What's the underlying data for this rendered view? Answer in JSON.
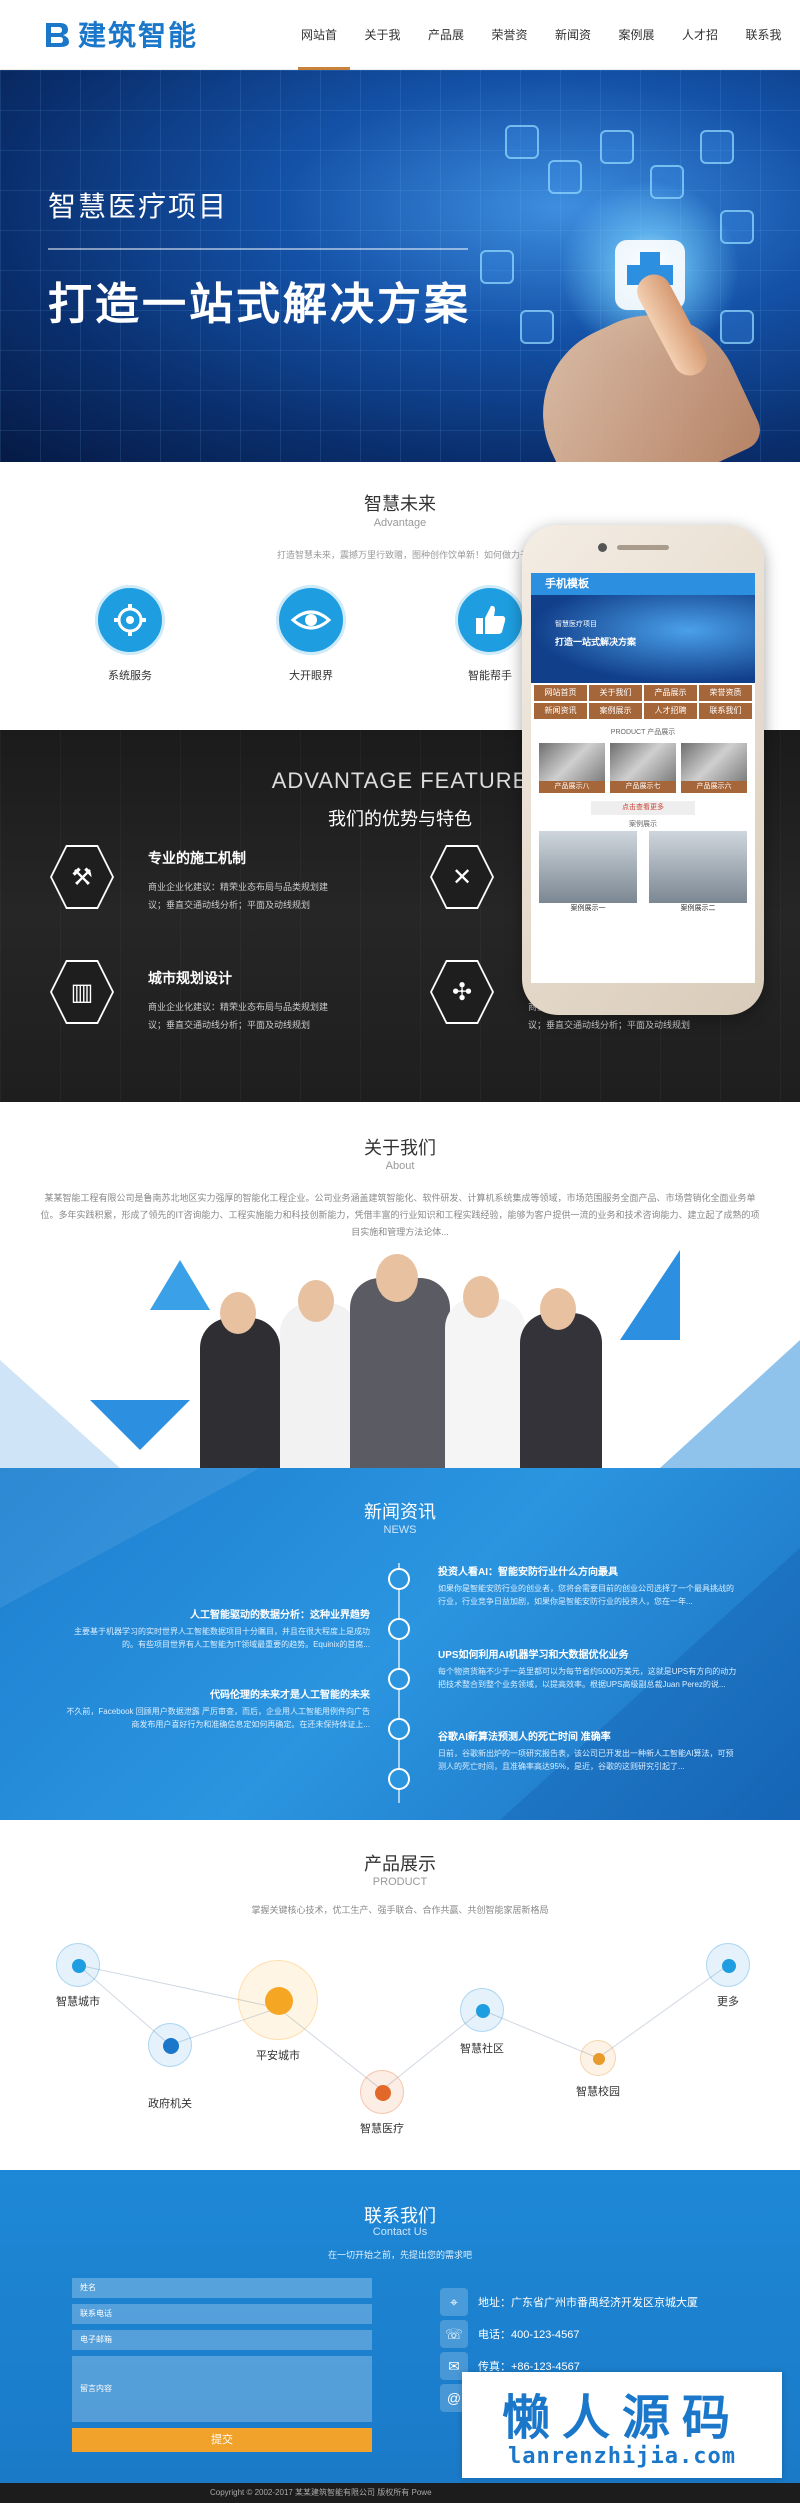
{
  "header": {
    "logo_text": "建筑智能",
    "nav": [
      "网站首页",
      "关于我们",
      "产品展示",
      "荣誉资质",
      "新闻资讯",
      "案例展示",
      "人才招聘",
      "联系我们"
    ]
  },
  "banner": {
    "title": "智慧医疗项目",
    "subtitle": "打造一站式解决方案"
  },
  "services": {
    "title": "智慧未来",
    "subtitle": "Advantage",
    "desc": "打造智慧未来，震撼万里行致赠，图种创作饮单新！如何做力于绿色智能营建",
    "items": [
      {
        "label": "系统服务",
        "icon": "gear-icon"
      },
      {
        "label": "大开眼界",
        "icon": "eye-icon"
      },
      {
        "label": "智能帮手",
        "icon": "thumbs-up-icon"
      }
    ]
  },
  "advantage": {
    "title_en": "ADVANTAGE FEATURE",
    "title_zh": "我们的优势与特色",
    "features": [
      {
        "title": "专业的施工机制",
        "desc": "商业企业化建议：精荣业态布局与品类规划建议；垂直交通动线分析；平面及动线规划",
        "icon": "crane-icon"
      },
      {
        "title": "城市规划设计",
        "desc": "商业企业化建议：精荣业态布局与品类规划建议；垂直交通动线分析；平面及动线规划",
        "icon": "buildings-icon"
      },
      {
        "title": "",
        "desc": "",
        "icon": "tools-icon"
      },
      {
        "title": "",
        "desc": "商业企业化建议：精荣业态布局与品类规划建议；垂直交通动线分析；平面及动线规划",
        "icon": "wind-turbine-icon"
      }
    ]
  },
  "about": {
    "title": "关于我们",
    "subtitle": "About",
    "desc": "某某智能工程有限公司是鲁南苏北地区实力强厚的智能化工程企业。公司业务涵盖建筑智能化、软件研发、计算机系统集成等领域，市场范围服务全面产品、市场营销化全面业务单位。多年实践积累，形成了领先的IT咨询能力、工程实施能力和科技创新能力，凭借丰富的行业知识和工程实践经验，能够为客户提供一流的业务和技术咨询能力、建立起了成熟的项目实施和管理方法论体..."
  },
  "news": {
    "title": "新闻资讯",
    "subtitle": "NEWS",
    "left": [
      {
        "title": "人工智能驱动的数据分析：这种业界趋势",
        "desc": "主要基于机器学习的实时世界人工智能数据项目十分瞩目，并且在很大程度上是成功的。有些项目世界有人工智能为IT领域最重要的趋势。Equinix的首席..."
      },
      {
        "title": "代码伦理的未来才是人工智能的未来",
        "desc": "不久前，Facebook 回顾用户数据泄露 严厉审查，而后，企业用人工智能用例件向广告商发布用户喜好行为和准确信息定如何再确定。在还未保持体证上..."
      }
    ],
    "right": [
      {
        "title": "投资人看AI：智能安防行业什么方向最具",
        "desc": "如果你是智能安防行业的创业者，您将会需要目前的创业公司选择了一个最具挑战的行业，行业竞争日益加剧，如果你是智能安防行业的投资人，您在一年..."
      },
      {
        "title": "UPS如何利用AI机器学习和大数据优化业务",
        "desc": "每个物资货箱不少于一英里都可以为每节省约5000万美元，这就是UPS有方向的动力把技术整合到整个业务领域，以提高效率。根据UPS高级副总裁Juan Perez的说..."
      },
      {
        "title": "谷歌AI新算法预测人的死亡时间 准确率",
        "desc": "日前，谷歌新出炉的一项研究报告表，该公司已开发出一种新人工智能AI算法，可预测人的死亡时间，且准确率高达95%，是近，谷歌的这则研究引起了..."
      }
    ]
  },
  "products": {
    "title": "产品展示",
    "subtitle": "PRODUCT",
    "desc": "掌握关键核心技术，优工生产、强手联合、合作共赢、共创智能家居新格局",
    "nodes": [
      "智慧城市",
      "政府机关",
      "平安城市",
      "智慧医疗",
      "智慧社区",
      "智慧校园",
      "更多"
    ]
  },
  "contact": {
    "title": "联系我们",
    "subtitle": "Contact Us",
    "desc": "在一切开始之前，先提出您的需求吧",
    "fields": [
      "姓名",
      "联系电话",
      "电子邮箱",
      "留言内容"
    ],
    "submit": "提交",
    "address": "地址：广东省广州市番禺经济开发区京城大厦",
    "phone": "电话：400-123-4567",
    "fax": "传真：+86-123-4567"
  },
  "footer": {
    "copyright": "Copyright © 2002-2017 某某建筑智能有限公司 版权所有 Powe"
  },
  "phone_mockup": {
    "app_title": "手机模板",
    "banner_t1": "智慧医疗项目",
    "banner_t2": "打造一站式解决方案",
    "nav": [
      "网站首页",
      "关于我们",
      "产品展示",
      "荣誉资质",
      "新闻资讯",
      "案例展示",
      "人才招聘",
      "联系我们"
    ],
    "product_head": "PRODUCT 产品展示",
    "products": [
      "产品展示八",
      "产品展示七",
      "产品展示六"
    ],
    "more": "点击查看更多",
    "case_head": "案例展示",
    "cases": [
      "案例展示一",
      "案例展示二"
    ]
  },
  "watermark": {
    "text": "懒人源码",
    "url": "lanrenzhijia.com"
  },
  "colors": {
    "brand": "#1a77c9",
    "accent": "#c8823a",
    "service_circle": "#1e9ee0",
    "news_bg": "#2b95e0",
    "submit": "#f0a22a"
  }
}
